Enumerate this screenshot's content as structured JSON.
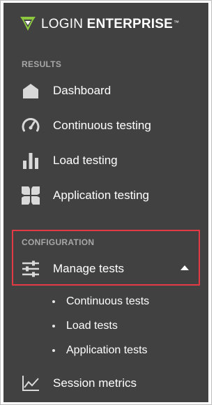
{
  "brand": {
    "name_part1": "LOGIN",
    "name_part2": "ENTERPRISE",
    "trademark": "™"
  },
  "sections": {
    "results_label": "RESULTS",
    "configuration_label": "CONFIGURATION"
  },
  "nav": {
    "dashboard": "Dashboard",
    "continuous_testing": "Continuous testing",
    "load_testing": "Load testing",
    "application_testing": "Application testing",
    "manage_tests": "Manage tests",
    "session_metrics": "Session metrics"
  },
  "submenu": {
    "continuous_tests": "Continuous tests",
    "load_tests": "Load tests",
    "application_tests": "Application tests"
  },
  "colors": {
    "sidebar_bg": "#414141",
    "highlight_border": "#e33a46",
    "logo_accent": "#8dc63f"
  }
}
